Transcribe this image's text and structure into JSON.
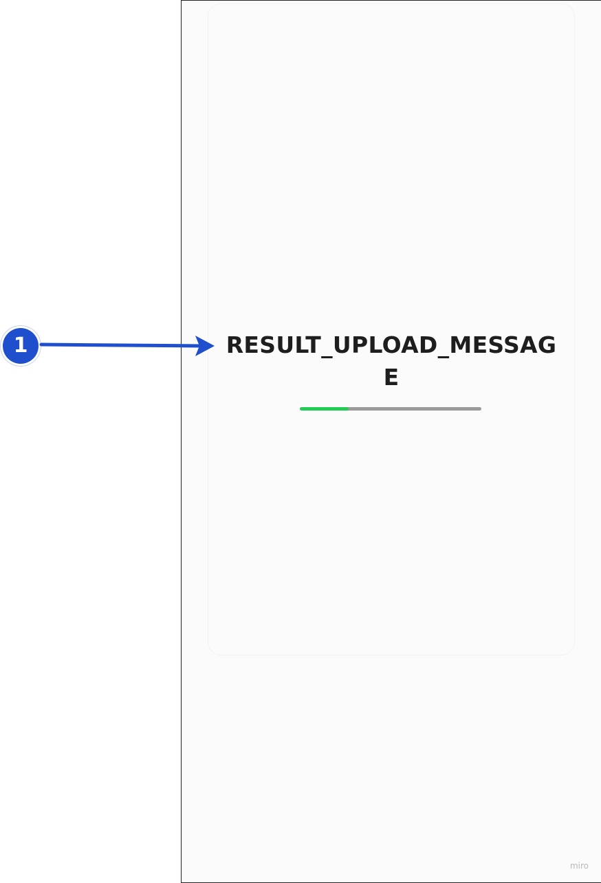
{
  "annotation": {
    "step_number": "1",
    "badge_color": "#1f4fcc",
    "arrow_color": "#1f4fcc"
  },
  "screen": {
    "message": "RESULT_UPLOAD_MESSAGE",
    "progress": {
      "fraction": 0.27,
      "fill_color": "#22cc55",
      "track_color": "#9a9a9a"
    }
  },
  "watermark": "miro"
}
